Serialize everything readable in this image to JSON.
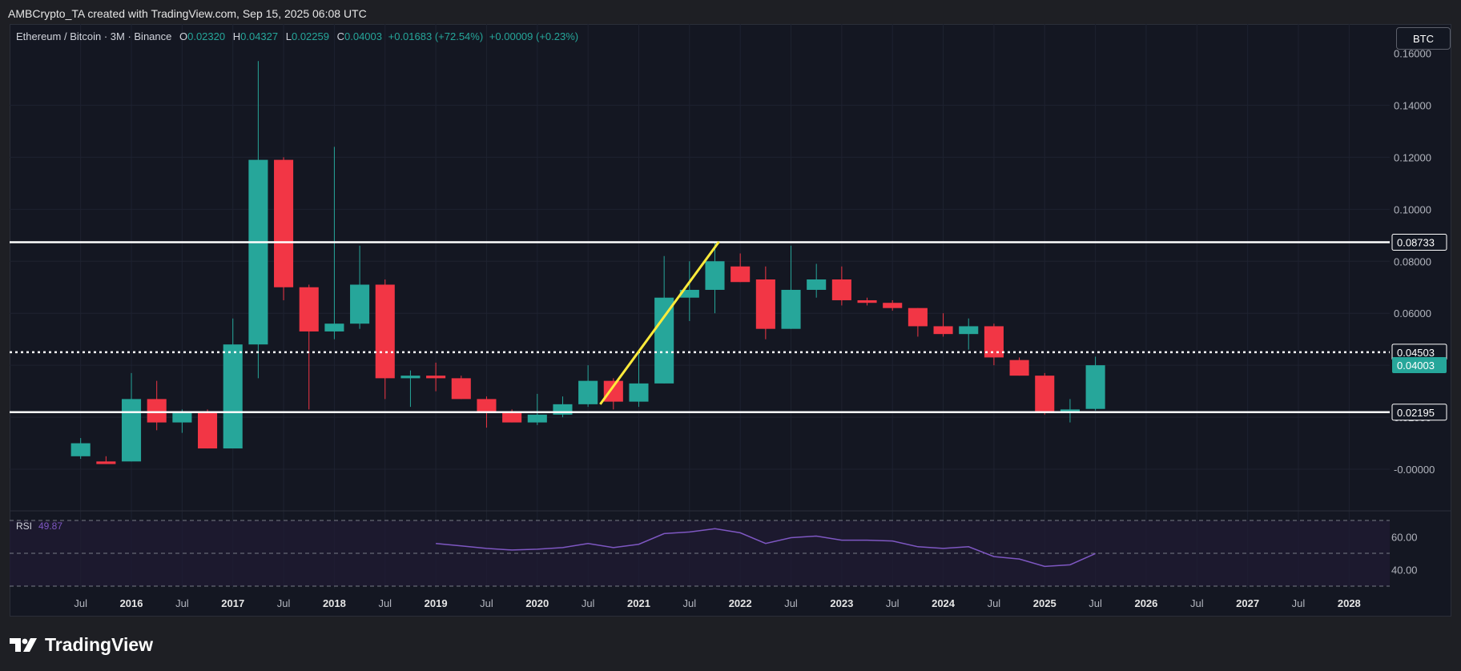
{
  "header": {
    "credit": "AMBCrypto_TA created with TradingView.com, Sep 15, 2025 06:08 UTC"
  },
  "legend": {
    "symbol": "Ethereum / Bitcoin · 3M · Binance",
    "o_label": "O",
    "o_value": "0.02320",
    "h_label": "H",
    "h_value": "0.04327",
    "l_label": "L",
    "l_value": "0.02259",
    "c_label": "C",
    "c_value": "0.04003",
    "change": "+0.01683 (+72.54%)",
    "extra": "+0.00009 (+0.23%)"
  },
  "currency_button": "BTC",
  "rsi": {
    "label": "RSI",
    "value": "49.87",
    "ticks": [
      "60.00",
      "40.00"
    ],
    "line_color": "#7e57c2"
  },
  "footer": {
    "brand": "TradingView"
  },
  "colors": {
    "up": "#26a69a",
    "down": "#f23645",
    "trend": "#ffeb3b",
    "level": "#ffffff"
  },
  "chart_data": {
    "type": "candlestick",
    "x_tick_labels": [
      "Jul",
      "2016",
      "Jul",
      "2017",
      "Jul",
      "2018",
      "Jul",
      "2019",
      "Jul",
      "2020",
      "Jul",
      "2021",
      "Jul",
      "2022",
      "Jul",
      "2023",
      "Jul",
      "2024",
      "Jul",
      "2025",
      "Jul",
      "2026",
      "Jul",
      "2027",
      "Jul",
      "2028"
    ],
    "x_tick_years": [
      2015.5,
      2016,
      2016.5,
      2017,
      2017.5,
      2018,
      2018.5,
      2019,
      2019.5,
      2020,
      2020.5,
      2021,
      2021.5,
      2022,
      2022.5,
      2023,
      2023.5,
      2024,
      2024.5,
      2025,
      2025.5,
      2026,
      2026.5,
      2027,
      2027.5,
      2028
    ],
    "x_range": [
      2014.8,
      2028.4
    ],
    "y_ticks": [
      0.14,
      0.12,
      0.1,
      0.08,
      0.06,
      0.04,
      0.02,
      0.0
    ],
    "y_tick_labels": [
      "0.14000",
      "0.12000",
      "0.10000",
      "0.08000",
      "0.06000",
      "0.04000",
      "0.02000",
      "-0.00000"
    ],
    "y_top_partial_label": "0.16000",
    "y_range": [
      -0.012,
      0.162
    ],
    "grid": true,
    "candles": [
      {
        "t": 2015.5,
        "o": 0.005,
        "h": 0.012,
        "l": 0.004,
        "c": 0.01
      },
      {
        "t": 2015.75,
        "o": 0.003,
        "h": 0.005,
        "l": 0.002,
        "c": 0.002
      },
      {
        "t": 2016.0,
        "o": 0.003,
        "h": 0.037,
        "l": 0.003,
        "c": 0.027
      },
      {
        "t": 2016.25,
        "o": 0.027,
        "h": 0.034,
        "l": 0.015,
        "c": 0.018
      },
      {
        "t": 2016.5,
        "o": 0.018,
        "h": 0.023,
        "l": 0.014,
        "c": 0.022
      },
      {
        "t": 2016.75,
        "o": 0.022,
        "h": 0.023,
        "l": 0.008,
        "c": 0.008
      },
      {
        "t": 2017.0,
        "o": 0.008,
        "h": 0.058,
        "l": 0.008,
        "c": 0.048
      },
      {
        "t": 2017.25,
        "o": 0.048,
        "h": 0.157,
        "l": 0.035,
        "c": 0.119
      },
      {
        "t": 2017.5,
        "o": 0.119,
        "h": 0.12,
        "l": 0.065,
        "c": 0.07
      },
      {
        "t": 2017.75,
        "o": 0.07,
        "h": 0.071,
        "l": 0.023,
        "c": 0.053
      },
      {
        "t": 2018.0,
        "o": 0.053,
        "h": 0.124,
        "l": 0.05,
        "c": 0.056
      },
      {
        "t": 2018.25,
        "o": 0.056,
        "h": 0.086,
        "l": 0.054,
        "c": 0.071
      },
      {
        "t": 2018.5,
        "o": 0.071,
        "h": 0.073,
        "l": 0.027,
        "c": 0.035
      },
      {
        "t": 2018.75,
        "o": 0.035,
        "h": 0.038,
        "l": 0.024,
        "c": 0.036
      },
      {
        "t": 2019.0,
        "o": 0.036,
        "h": 0.041,
        "l": 0.03,
        "c": 0.035
      },
      {
        "t": 2019.25,
        "o": 0.035,
        "h": 0.036,
        "l": 0.027,
        "c": 0.027
      },
      {
        "t": 2019.5,
        "o": 0.027,
        "h": 0.028,
        "l": 0.016,
        "c": 0.022
      },
      {
        "t": 2019.75,
        "o": 0.022,
        "h": 0.023,
        "l": 0.018,
        "c": 0.018
      },
      {
        "t": 2020.0,
        "o": 0.018,
        "h": 0.029,
        "l": 0.017,
        "c": 0.021
      },
      {
        "t": 2020.25,
        "o": 0.021,
        "h": 0.028,
        "l": 0.02,
        "c": 0.025
      },
      {
        "t": 2020.5,
        "o": 0.025,
        "h": 0.04,
        "l": 0.024,
        "c": 0.034
      },
      {
        "t": 2020.75,
        "o": 0.034,
        "h": 0.035,
        "l": 0.023,
        "c": 0.026
      },
      {
        "t": 2021.0,
        "o": 0.026,
        "h": 0.045,
        "l": 0.024,
        "c": 0.033
      },
      {
        "t": 2021.25,
        "o": 0.033,
        "h": 0.082,
        "l": 0.033,
        "c": 0.066
      },
      {
        "t": 2021.5,
        "o": 0.066,
        "h": 0.08,
        "l": 0.057,
        "c": 0.069
      },
      {
        "t": 2021.75,
        "o": 0.069,
        "h": 0.087,
        "l": 0.06,
        "c": 0.08
      },
      {
        "t": 2022.0,
        "o": 0.078,
        "h": 0.083,
        "l": 0.072,
        "c": 0.072
      },
      {
        "t": 2022.25,
        "o": 0.073,
        "h": 0.078,
        "l": 0.05,
        "c": 0.054
      },
      {
        "t": 2022.5,
        "o": 0.054,
        "h": 0.086,
        "l": 0.054,
        "c": 0.069
      },
      {
        "t": 2022.75,
        "o": 0.069,
        "h": 0.079,
        "l": 0.066,
        "c": 0.073
      },
      {
        "t": 2023.0,
        "o": 0.073,
        "h": 0.078,
        "l": 0.063,
        "c": 0.065
      },
      {
        "t": 2023.25,
        "o": 0.065,
        "h": 0.066,
        "l": 0.063,
        "c": 0.064
      },
      {
        "t": 2023.5,
        "o": 0.064,
        "h": 0.065,
        "l": 0.061,
        "c": 0.062
      },
      {
        "t": 2023.75,
        "o": 0.062,
        "h": 0.062,
        "l": 0.051,
        "c": 0.055
      },
      {
        "t": 2024.0,
        "o": 0.055,
        "h": 0.06,
        "l": 0.051,
        "c": 0.052
      },
      {
        "t": 2024.25,
        "o": 0.052,
        "h": 0.058,
        "l": 0.046,
        "c": 0.055
      },
      {
        "t": 2024.5,
        "o": 0.055,
        "h": 0.056,
        "l": 0.04,
        "c": 0.043
      },
      {
        "t": 2024.75,
        "o": 0.042,
        "h": 0.043,
        "l": 0.036,
        "c": 0.036
      },
      {
        "t": 2025.0,
        "o": 0.036,
        "h": 0.037,
        "l": 0.021,
        "c": 0.022
      },
      {
        "t": 2025.25,
        "o": 0.022,
        "h": 0.027,
        "l": 0.018,
        "c": 0.023
      },
      {
        "t": 2025.5,
        "o": 0.0232,
        "h": 0.0433,
        "l": 0.0226,
        "c": 0.04
      }
    ],
    "horizontal_levels": [
      {
        "value": 0.08733,
        "label": "0.08733",
        "style": "solid"
      },
      {
        "value": 0.04503,
        "label": "0.04503",
        "style": "dotted"
      },
      {
        "value": 0.02195,
        "label": "0.02195",
        "style": "solid"
      }
    ],
    "last_price": {
      "value": 0.04003,
      "label": "0.04003"
    },
    "trendline": {
      "from": {
        "t": 2020.62,
        "v": 0.025
      },
      "to": {
        "t": 2021.79,
        "v": 0.0875
      }
    },
    "rsi_series": {
      "t": [
        2019.0,
        2019.25,
        2019.5,
        2019.75,
        2020.0,
        2020.25,
        2020.5,
        2020.75,
        2021.0,
        2021.25,
        2021.5,
        2021.75,
        2022.0,
        2022.25,
        2022.5,
        2022.75,
        2023.0,
        2023.25,
        2023.5,
        2023.75,
        2024.0,
        2024.25,
        2024.5,
        2024.75,
        2025.0,
        2025.25,
        2025.5
      ],
      "v": [
        56,
        54.5,
        53,
        52,
        52.5,
        53.5,
        56,
        53.5,
        55.5,
        62,
        63,
        65,
        62.5,
        56,
        59.5,
        60.5,
        58,
        58,
        57.5,
        54,
        53,
        54,
        48,
        46.5,
        42,
        43,
        49.87
      ]
    },
    "rsi_range": [
      30,
      70
    ],
    "rsi_bands": [
      70,
      50,
      30
    ]
  }
}
